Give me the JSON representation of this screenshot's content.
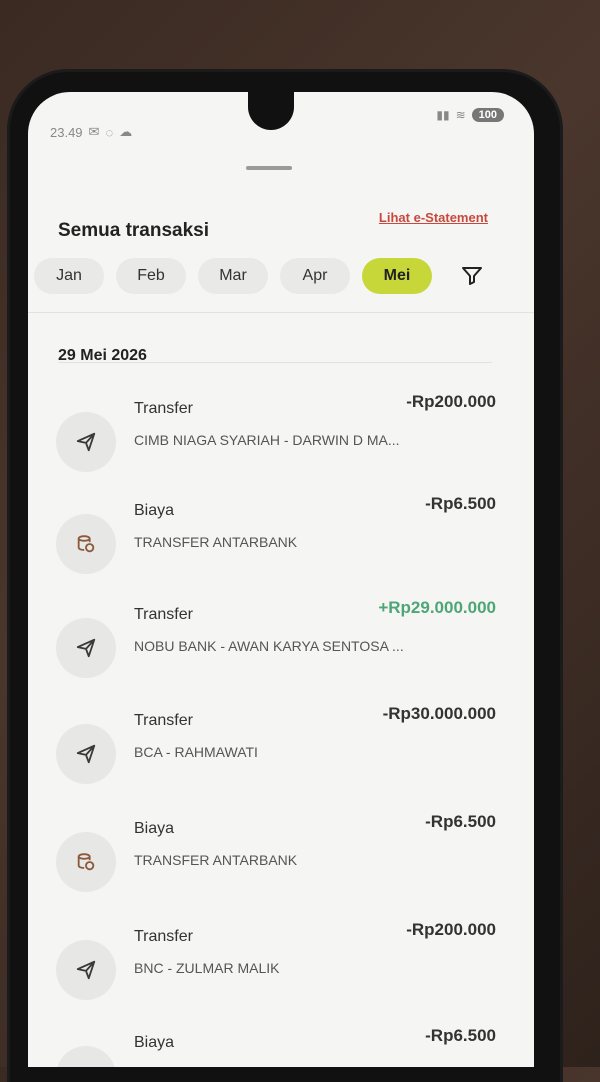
{
  "status_bar": {
    "time": "23.49",
    "battery": "100"
  },
  "header": {
    "title": "Semua transaksi",
    "estatement_link": "Lihat e-Statement"
  },
  "months": [
    "Jan",
    "Feb",
    "Mar",
    "Apr",
    "Mei"
  ],
  "active_month": "Mei",
  "date_group": "29 Mei 2026",
  "transactions": [
    {
      "type": "Transfer",
      "icon": "send-icon",
      "desc": "CIMB NIAGA SYARIAH - DARWIN D MA...",
      "amount": "-Rp200.000"
    },
    {
      "type": "Biaya",
      "icon": "coins-icon",
      "desc": "TRANSFER ANTARBANK",
      "amount": "-Rp6.500"
    },
    {
      "type": "Transfer",
      "icon": "send-icon",
      "desc": "NOBU BANK - AWAN KARYA SENTOSA ...",
      "amount": "+Rp29.000.000"
    },
    {
      "type": "Transfer",
      "icon": "send-icon",
      "desc": "BCA - RAHMAWATI",
      "amount": "-Rp30.000.000"
    },
    {
      "type": "Biaya",
      "icon": "coins-icon",
      "desc": "TRANSFER ANTARBANK",
      "amount": "-Rp6.500"
    },
    {
      "type": "Transfer",
      "icon": "send-icon",
      "desc": "BNC - ZULMAR MALIK",
      "amount": "-Rp200.000"
    },
    {
      "type": "Biaya",
      "icon": "coins-icon",
      "desc": "",
      "amount": "-Rp6.500"
    }
  ],
  "colors": {
    "accent": "#c7d73a",
    "link": "#c9483e",
    "positive": "#4ea676"
  }
}
